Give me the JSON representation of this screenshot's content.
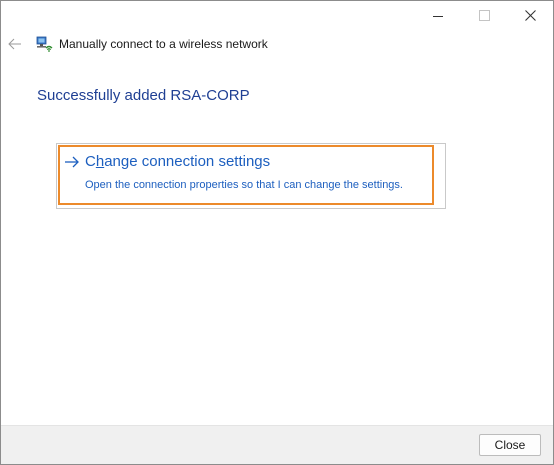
{
  "window": {
    "title": "Manually connect to a wireless network"
  },
  "caption": {
    "minimize_icon": "minimize-icon",
    "maximize_icon": "maximize-icon",
    "close_icon": "close-icon"
  },
  "main": {
    "heading": "Successfully added RSA-CORP",
    "option": {
      "title_prefix": "C",
      "title_underlined": "h",
      "title_rest": "ange connection settings",
      "description": "Open the connection properties so that I can change the settings.",
      "arrow_icon": "arrow-right-icon"
    }
  },
  "footer": {
    "close_label": "Close"
  },
  "colors": {
    "link": "#1d5fbf",
    "heading": "#1f3f93",
    "focus_border": "#ec8a2b"
  }
}
